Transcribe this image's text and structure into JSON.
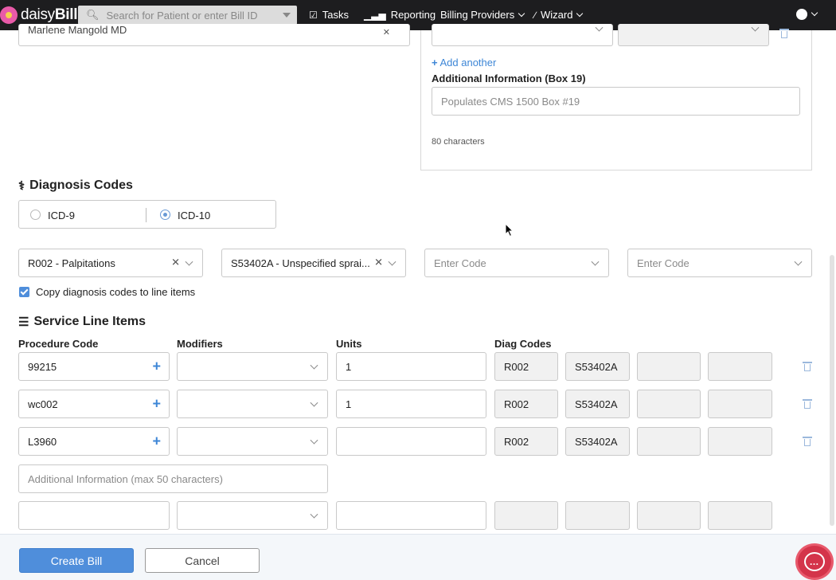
{
  "nav": {
    "brand_prefix": "daisy",
    "brand_bold": "Bill",
    "search_placeholder": "Search for Patient or enter Bill ID",
    "tasks": "Tasks",
    "reporting": "Reporting",
    "billing_providers": "Billing Providers",
    "wizard": "Wizard"
  },
  "top": {
    "provider_value": "Marlene Mangold MD",
    "add_another": "Add another",
    "box19_label": "Additional Information (Box 19)",
    "box19_placeholder": "Populates CMS 1500 Box #19",
    "char_count": "80 characters"
  },
  "diagnosis": {
    "heading": "Diagnosis Codes",
    "icd9": "ICD-9",
    "icd10": "ICD-10",
    "selected": "ICD-10",
    "codes": [
      "R002 - Palpitations",
      "S53402A - Unspecified sprai..."
    ],
    "enter_code_placeholder": "Enter Code",
    "copy_label": "Copy diagnosis codes to line items",
    "copy_checked": true
  },
  "service": {
    "heading": "Service Line Items",
    "col_procedure": "Procedure Code",
    "col_modifiers": "Modifiers",
    "col_units": "Units",
    "col_diag": "Diag Codes",
    "rows": [
      {
        "procedure": "99215",
        "units": "1",
        "diag1": "R002",
        "diag2": "S53402A"
      },
      {
        "procedure": "wc002",
        "units": "1",
        "diag1": "R002",
        "diag2": "S53402A"
      },
      {
        "procedure": "L3960",
        "units": "",
        "diag1": "R002",
        "diag2": "S53402A"
      }
    ],
    "additional_placeholder": "Additional Information (max 50 characters)"
  },
  "footer": {
    "create": "Create Bill",
    "cancel": "Cancel"
  },
  "colors": {
    "accent": "#4f8edb",
    "navbar": "#1d1d1f",
    "chat": "#d4344a"
  }
}
